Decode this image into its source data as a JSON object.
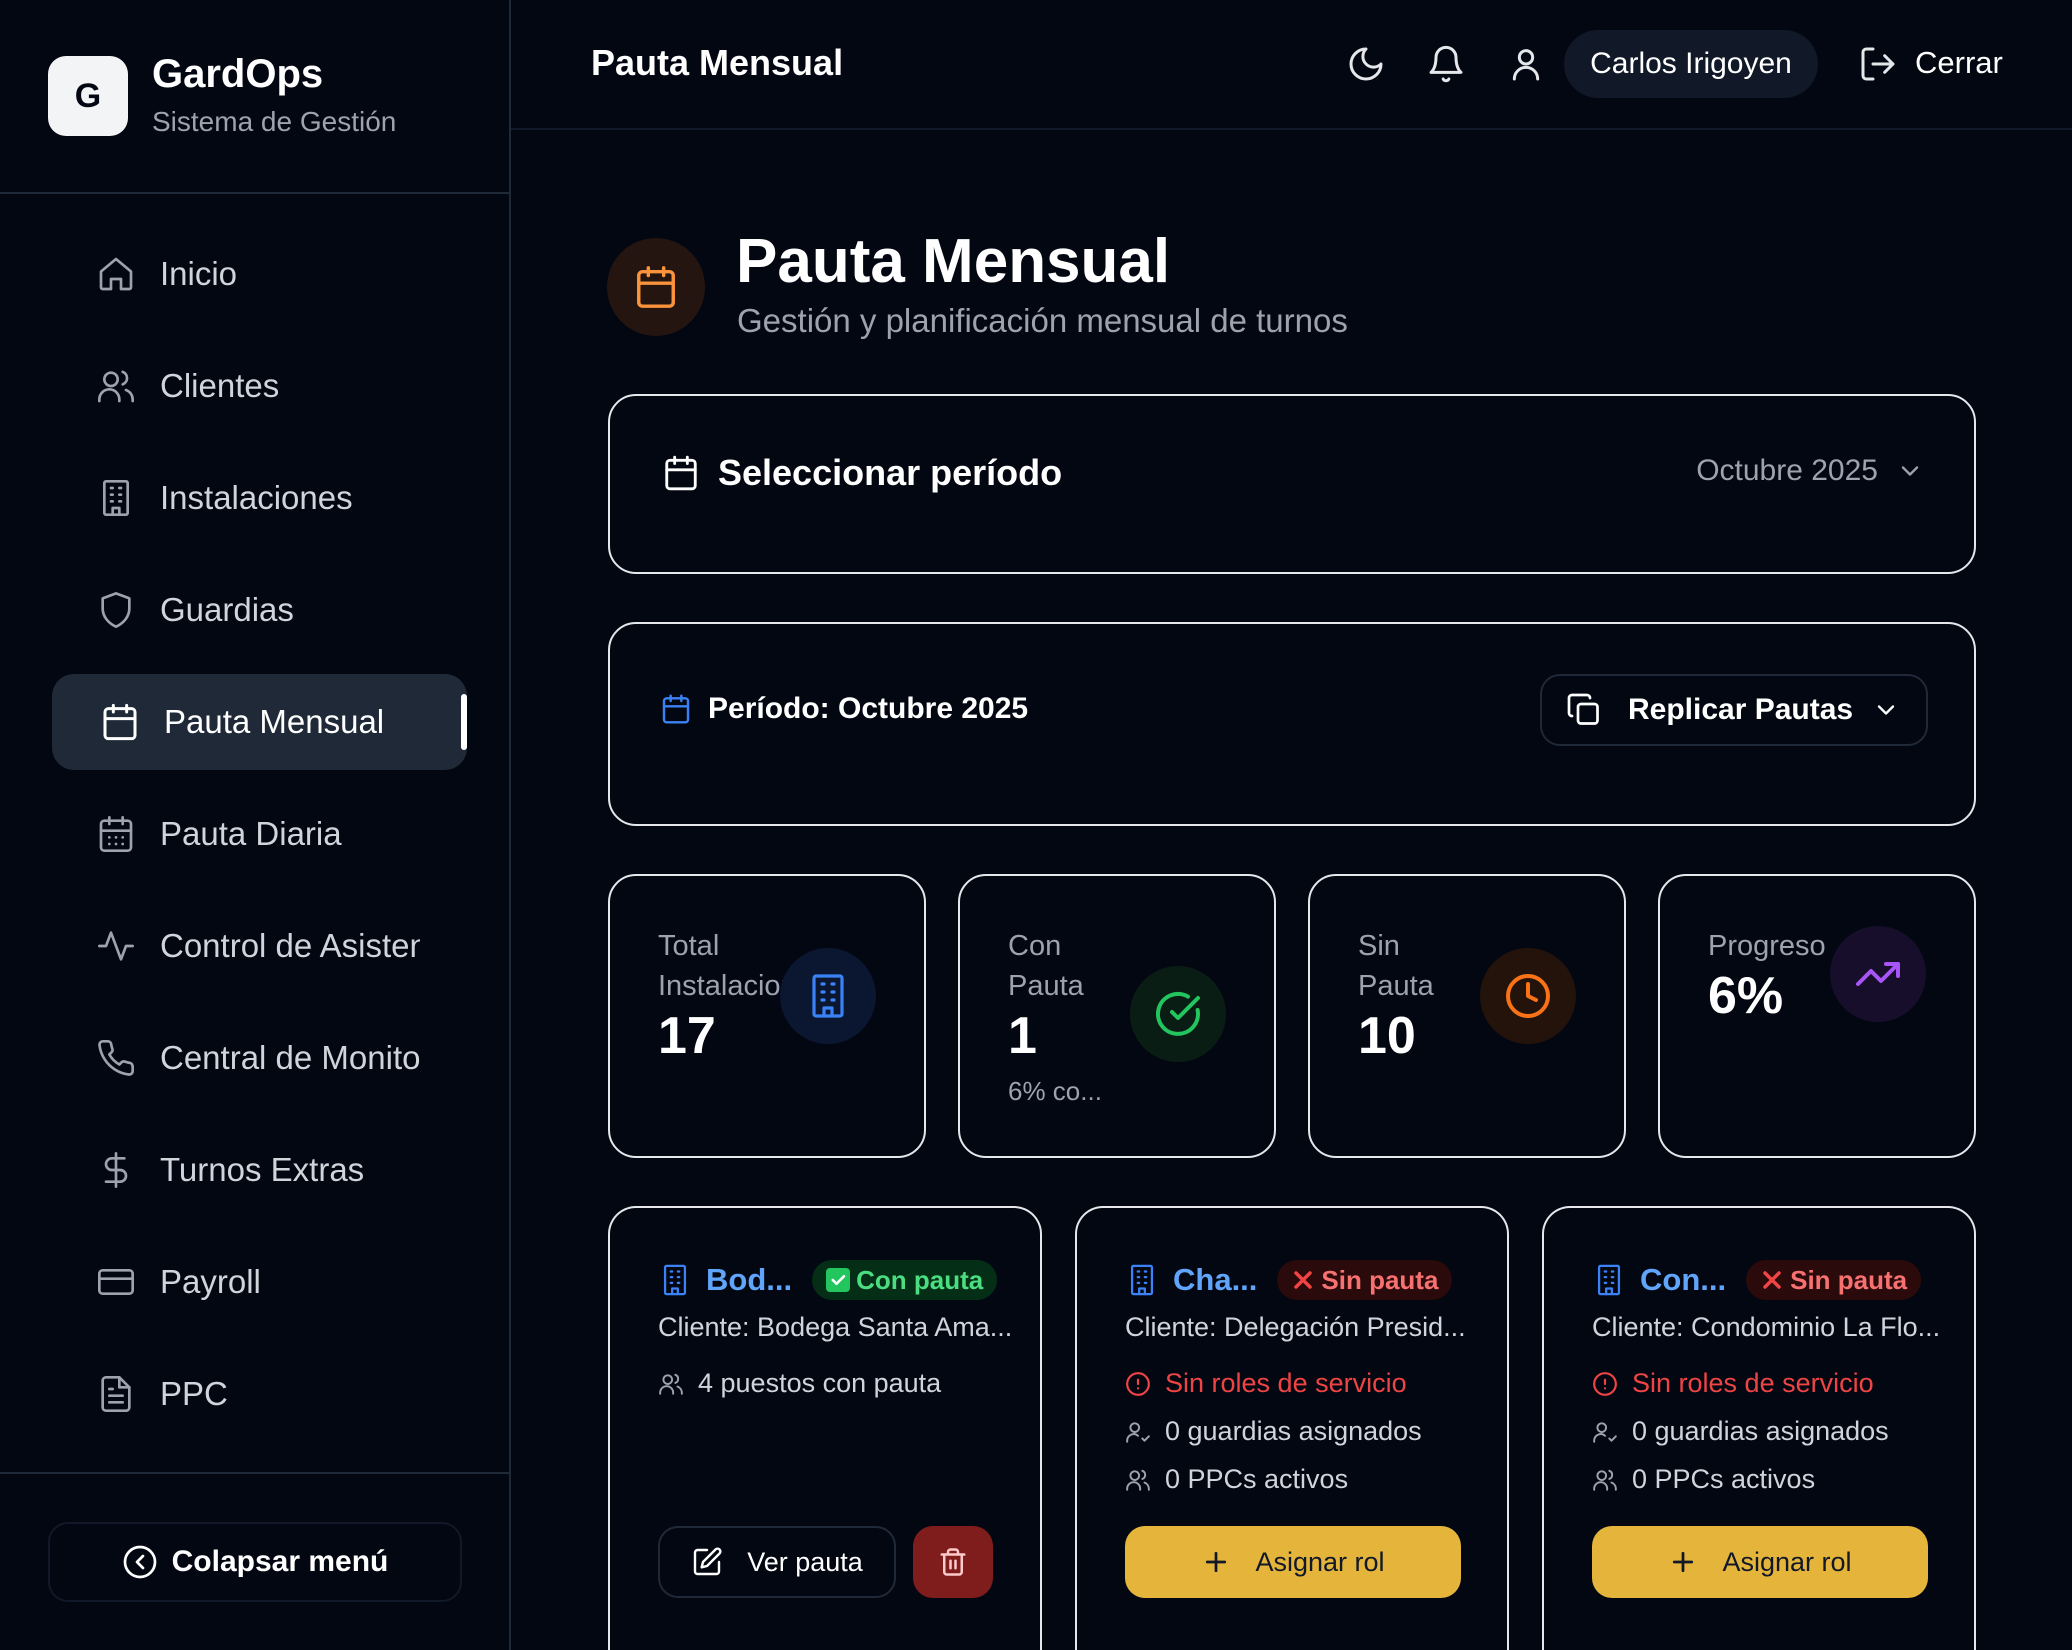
{
  "brand": {
    "logo_letter": "G",
    "name": "GardOps",
    "subtitle": "Sistema de Gestión"
  },
  "sidebar": {
    "items": [
      {
        "label": "Inicio",
        "icon": "home-icon"
      },
      {
        "label": "Clientes",
        "icon": "users-icon"
      },
      {
        "label": "Instalaciones",
        "icon": "building-icon"
      },
      {
        "label": "Guardias",
        "icon": "shield-icon"
      },
      {
        "label": "Pauta Mensual",
        "icon": "calendar-icon",
        "active": true
      },
      {
        "label": "Pauta Diaria",
        "icon": "calendar-days-icon"
      },
      {
        "label": "Control de Asistencias",
        "icon": "activity-icon"
      },
      {
        "label": "Central de Monitoreo",
        "icon": "phone-icon"
      },
      {
        "label": "Turnos Extras",
        "icon": "dollar-icon"
      },
      {
        "label": "Payroll",
        "icon": "credit-card-icon"
      },
      {
        "label": "PPC",
        "icon": "file-icon"
      }
    ],
    "collapse_label": "Colapsar menú"
  },
  "header": {
    "title": "Pauta Mensual",
    "user_name": "Carlos Irigoyen",
    "logout_label": "Cerrar",
    "icons": [
      "moon-icon",
      "bell-icon",
      "user-icon",
      "logout-icon"
    ]
  },
  "page": {
    "title": "Pauta Mensual",
    "subtitle": "Gestión y planificación mensual de turnos"
  },
  "period_selector": {
    "label": "Seleccionar período",
    "selected": "Octubre 2025"
  },
  "replicate": {
    "current_period": "Período: Octubre 2025",
    "button_label": "Replicar Pautas"
  },
  "stats": [
    {
      "label": "Total Instalaciones",
      "value": "17",
      "note": "",
      "icon": "building-icon",
      "color": "#3b82f6"
    },
    {
      "label": "Con Pauta",
      "value": "1",
      "note": "6% co...",
      "icon": "check-circle-icon",
      "color": "#22c55e"
    },
    {
      "label": "Sin Pauta",
      "value": "10",
      "note": "",
      "icon": "clock-icon",
      "color": "#f97316"
    },
    {
      "label": "Progreso",
      "value": "6%",
      "note": "",
      "icon": "trending-up-icon",
      "color": "#a855f7"
    }
  ],
  "installations": [
    {
      "name": "Bod...",
      "status": "Con pauta",
      "status_icon": "✅",
      "client": "Cliente: Bodega Santa Ama...",
      "puestos": "4 puestos con pauta",
      "view_label": "Ver pauta"
    },
    {
      "name": "Cha...",
      "status": "Sin pauta",
      "status_icon": "❌",
      "client": "Cliente: Delegación Presid...",
      "warning": "Sin roles de servicio",
      "guards": "0 guardias asignados",
      "ppcs": "0 PPCs activos",
      "assign_label": "Asignar rol"
    },
    {
      "name": "Con...",
      "status": "Sin pauta",
      "status_icon": "❌",
      "client": "Cliente: Condominio La Flo...",
      "warning": "Sin roles de servicio",
      "guards": "0 guardias asignados",
      "ppcs": "0 PPCs activos",
      "assign_label": "Asignar rol"
    }
  ],
  "colors": {
    "background": "#030712",
    "accent_yellow": "#e5b53b",
    "danger": "#ef4444",
    "link_blue": "#60a5fa"
  }
}
